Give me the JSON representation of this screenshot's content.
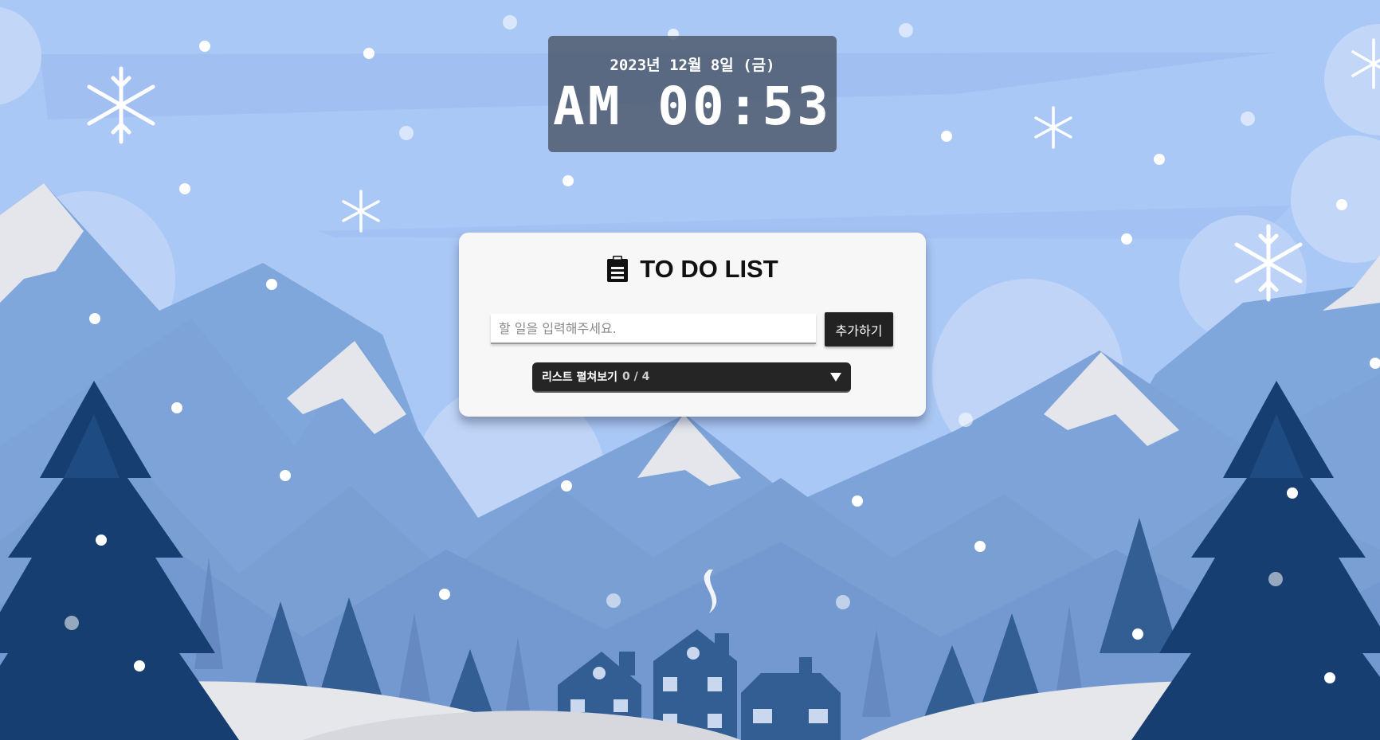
{
  "clock": {
    "date": "2023년 12월 8일 (금)",
    "time": "AM 00:53"
  },
  "todo": {
    "title": "TO DO LIST",
    "title_icon": "clipboard-icon",
    "input_placeholder": "할 일을 입력해주세요.",
    "input_value": "",
    "add_button": "추가하기",
    "list_toggle_label": "리스트 펼쳐보기",
    "list_count": "0 / 4",
    "list_toggle_icon": "triangle-down-icon"
  },
  "colors": {
    "sky": "#a9c6f4",
    "card": "#f7f7f7",
    "button": "#222222",
    "tree_dark": "#1a4275",
    "tree_mid": "#335e94"
  }
}
